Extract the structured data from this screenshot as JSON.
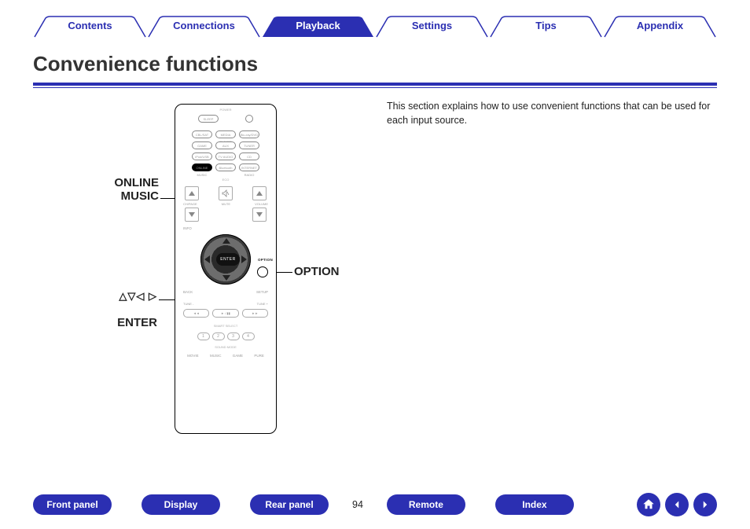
{
  "tabs": {
    "items": [
      "Contents",
      "Connections",
      "Playback",
      "Settings",
      "Tips",
      "Appendix"
    ],
    "active_index": 2
  },
  "page": {
    "title": "Convenience functions",
    "number": "94",
    "body_text": "This section explains how to use convenient functions that can be used for each input source."
  },
  "callouts": {
    "online_music": "ONLINE\nMUSIC",
    "option": "OPTION",
    "enter_arrows": "△▽◁ ▷",
    "enter": "ENTER"
  },
  "remote": {
    "power_label": "POWER",
    "sleep": "SLEEP",
    "row1": [
      "CBL/SAT",
      "MEDIA PLAYER",
      "Blu-ray/DVD"
    ],
    "row2": [
      "GAME",
      "AUX",
      "TUNER"
    ],
    "row3": [
      "iPod/USB",
      "TV AUDIO",
      "CD"
    ],
    "row4": [
      "ONLINE MUSIC",
      "Bluetooth",
      "INTERNET RADIO"
    ],
    "eco": "ECO",
    "ch_page": "CH/PAGE",
    "mute": "MUTE",
    "volume": "VOLUME",
    "info": "INFO",
    "option_label": "OPTION",
    "enter_label": "ENTER",
    "back": "BACK",
    "setup": "SETUP",
    "tune_minus": "TUNE -",
    "tune_plus": "TUNE +",
    "transport": [
      "◄◄",
      "► / ▮▮",
      "►►"
    ],
    "smart_select_label": "SMART SELECT",
    "smart_select": [
      "1",
      "2",
      "3",
      "4"
    ],
    "sound_mode_label": "SOUND MODE",
    "sound_modes": [
      "MOVIE",
      "MUSIC",
      "GAME",
      "PURE"
    ]
  },
  "bottom_nav": {
    "buttons": [
      "Front panel",
      "Display",
      "Rear panel",
      "Remote",
      "Index"
    ],
    "icons": [
      "home-icon",
      "prev-icon",
      "next-icon"
    ]
  },
  "colors": {
    "brand": "#2b2fb2"
  }
}
